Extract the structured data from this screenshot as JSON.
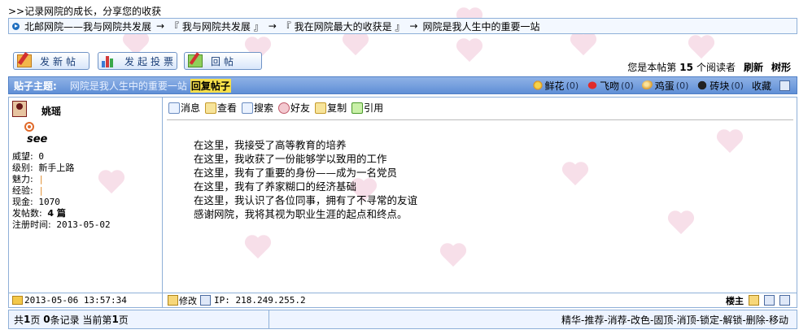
{
  "header": {
    "title": ">>记录网院的成长，分享您的收获"
  },
  "breadcrumb": {
    "items": [
      "北邮网院——我与网院共发展",
      "『 我与网院共发展 』",
      "『 我在网院最大的收获是 』",
      "网院是我人生中的重要一站"
    ],
    "separator": "→"
  },
  "actions": {
    "new_post": "发新帖",
    "new_vote": "发起投票",
    "reply": "回帖"
  },
  "reader_info": {
    "prefix": "您是本帖第",
    "count": "15",
    "suffix": "个阅读者",
    "refresh": "刷新",
    "tree": "树形"
  },
  "topic": {
    "label": "贴子主题:",
    "title": "网院是我人生中的重要一站",
    "reply_link": "回复帖子",
    "ratings": [
      {
        "label": "鲜花",
        "count": "(0)",
        "icon": "flower-icon"
      },
      {
        "label": "飞吻",
        "count": "(0)",
        "icon": "kiss-icon"
      },
      {
        "label": "鸡蛋",
        "count": "(0)",
        "icon": "egg-icon"
      },
      {
        "label": "砖块",
        "count": "(0)",
        "icon": "brick-icon"
      }
    ],
    "favorite": "收藏"
  },
  "user": {
    "name": "姚瑶",
    "tagline": "see",
    "stats": [
      {
        "k": "威望:",
        "v": "0"
      },
      {
        "k": "级别:",
        "v": "新手上路"
      },
      {
        "k": "魅力:",
        "v": "|"
      },
      {
        "k": "经验:",
        "v": "|"
      },
      {
        "k": "现金:",
        "v": "1070"
      },
      {
        "k": "发帖数:",
        "v": "4 篇"
      },
      {
        "k": "注册时间:",
        "v": "2013-05-02"
      }
    ]
  },
  "post_tools": [
    "消息",
    "查看",
    "搜索",
    "好友",
    "复制",
    "引用"
  ],
  "post_body": [
    "在这里，我接受了高等教育的培养",
    "在这里，我收获了一份能够学以致用的工作",
    "在这里，我有了重要的身份——成为一名党员",
    "在这里，我有了养家糊口的经济基础",
    "在这里，我认识了各位同事，拥有了不寻常的友谊",
    "感谢网院，我将其视为职业生涯的起点和终点。"
  ],
  "post_footer": {
    "time": "2013-05-06 13:57:34",
    "edit": "修改",
    "ip": "IP: 218.249.255.2",
    "floor": "楼主"
  },
  "pager": {
    "total_pages_label": "共",
    "total_pages": "1",
    "pages_unit": "页",
    "records": "0",
    "records_unit": "条记录",
    "current_label": "当前第",
    "current": "1",
    "current_unit": "页"
  },
  "admin_links": "精华-推荐-消荐-改色-固顶-消顶-锁定-解锁-删除-移动"
}
